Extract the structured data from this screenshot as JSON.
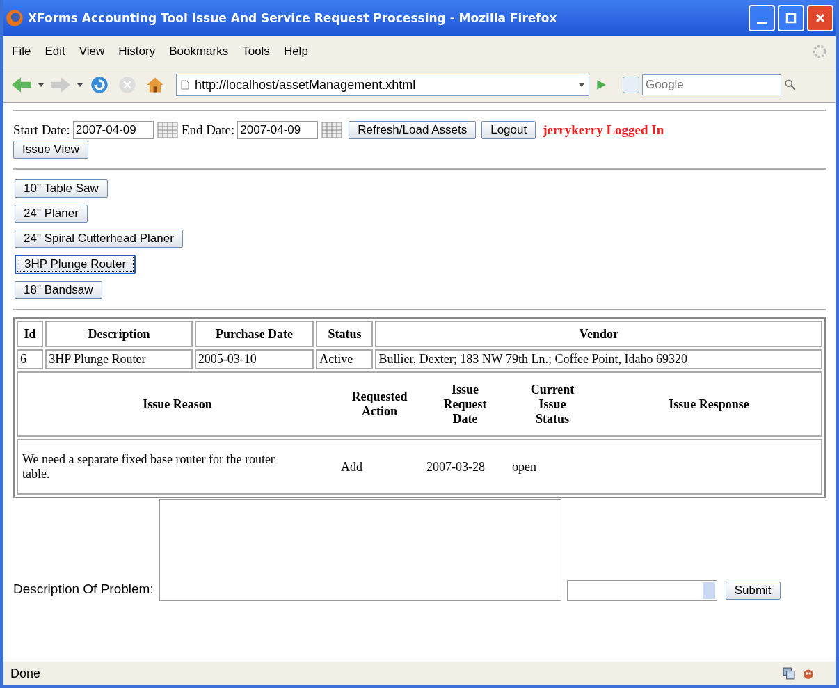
{
  "window": {
    "title": "XForms Accounting Tool Issue And Service Request Processing - Mozilla Firefox"
  },
  "menu": [
    "File",
    "Edit",
    "View",
    "History",
    "Bookmarks",
    "Tools",
    "Help"
  ],
  "address_bar": {
    "value": "http://localhost/assetManagement.xhtml"
  },
  "search": {
    "placeholder": "Google"
  },
  "filters": {
    "start_label": "Start Date:",
    "start_value": "2007-04-09",
    "end_label": "End Date:",
    "end_value": "2007-04-09",
    "refresh_button": "Refresh/Load Assets",
    "logout_button": "Logout",
    "user_status": "jerrykerry Logged In",
    "issue_view_button": "Issue View"
  },
  "assets": [
    {
      "label": "10\" Table Saw",
      "selected": false
    },
    {
      "label": "24\" Planer",
      "selected": false
    },
    {
      "label": "24\" Spiral Cutterhead Planer",
      "selected": false
    },
    {
      "label": "3HP Plunge Router",
      "selected": true
    },
    {
      "label": "18\" Bandsaw",
      "selected": false
    }
  ],
  "asset_table": {
    "columns": [
      "Id",
      "Description",
      "Purchase Date",
      "Status",
      "Vendor"
    ],
    "rows": [
      [
        "6",
        "3HP Plunge Router",
        "2005-03-10",
        "Active",
        "Bullier, Dexter; 183 NW 79th Ln.; Coffee Point, Idaho 69320"
      ]
    ]
  },
  "issue_table": {
    "columns": [
      "Issue Reason",
      "Requested Action",
      "Issue Request Date",
      "Current Issue Status",
      "Issue Response"
    ],
    "rows": [
      [
        "We need a separate fixed base router for the router table.",
        "Add",
        "2007-03-28",
        "open",
        ""
      ]
    ]
  },
  "problem_form": {
    "label": "Description Of Problem:",
    "submit_button": "Submit"
  },
  "status_bar": "Done"
}
